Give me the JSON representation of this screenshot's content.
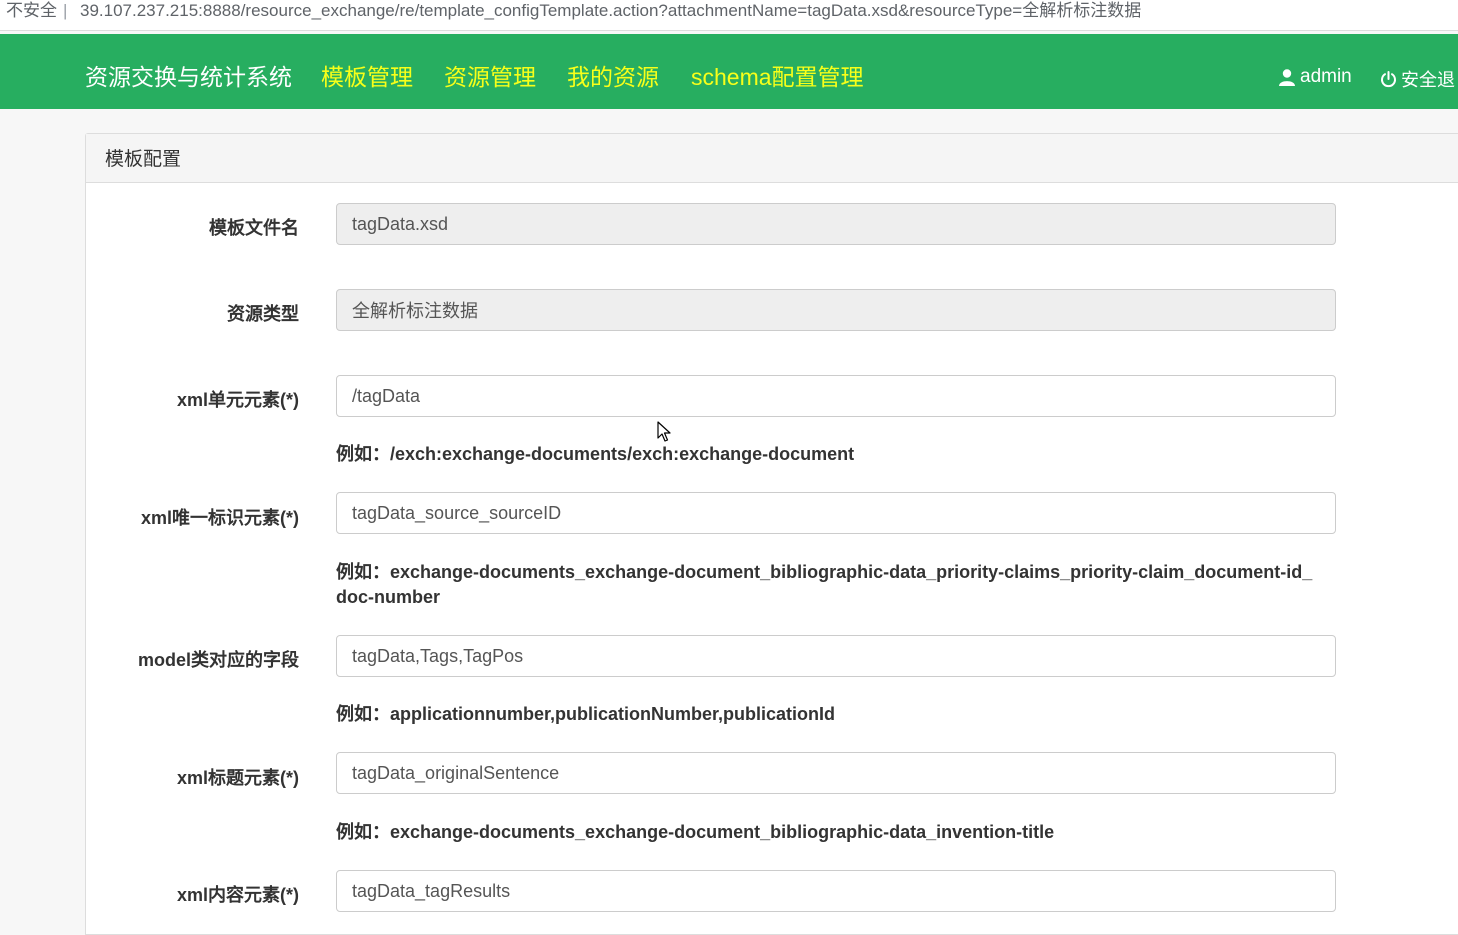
{
  "address_bar": {
    "security": "不安全",
    "url": "39.107.237.215:8888/resource_exchange/re/template_configTemplate.action?attachmentName=tagData.xsd&resourceType=全解析标注数据"
  },
  "nav": {
    "brand": "资源交换与统计系统",
    "links": [
      "模板管理",
      "资源管理",
      "我的资源",
      "schema配置管理"
    ],
    "user": "admin",
    "logout": "安全退"
  },
  "panel": {
    "title": "模板配置",
    "fields": [
      {
        "label": "模板文件名",
        "value": "tagData.xsd",
        "readonly": true
      },
      {
        "label": "资源类型",
        "value": "全解析标注数据",
        "readonly": true
      },
      {
        "label": "xml单元元素(*)",
        "value": "/tagData",
        "hint": "例如：/exch:exchange-documents/exch:exchange-document"
      },
      {
        "label": "xml唯一标识元素(*)",
        "value": "tagData_source_sourceID",
        "hint": "例如：exchange-documents_exchange-document_bibliographic-data_priority-claims_priority-claim_document-id_doc-number"
      },
      {
        "label": "model类对应的字段",
        "value": "tagData,Tags,TagPos",
        "hint": "例如：applicationnumber,publicationNumber,publicationId"
      },
      {
        "label": "xml标题元素(*)",
        "value": "tagData_originalSentence",
        "hint": "例如：exchange-documents_exchange-document_bibliographic-data_invention-title"
      },
      {
        "label": "xml内容元素(*)",
        "value": "tagData_tagResults"
      }
    ]
  },
  "colors": {
    "navbar": "#27ae60",
    "nav_link": "#f7ff1a"
  }
}
